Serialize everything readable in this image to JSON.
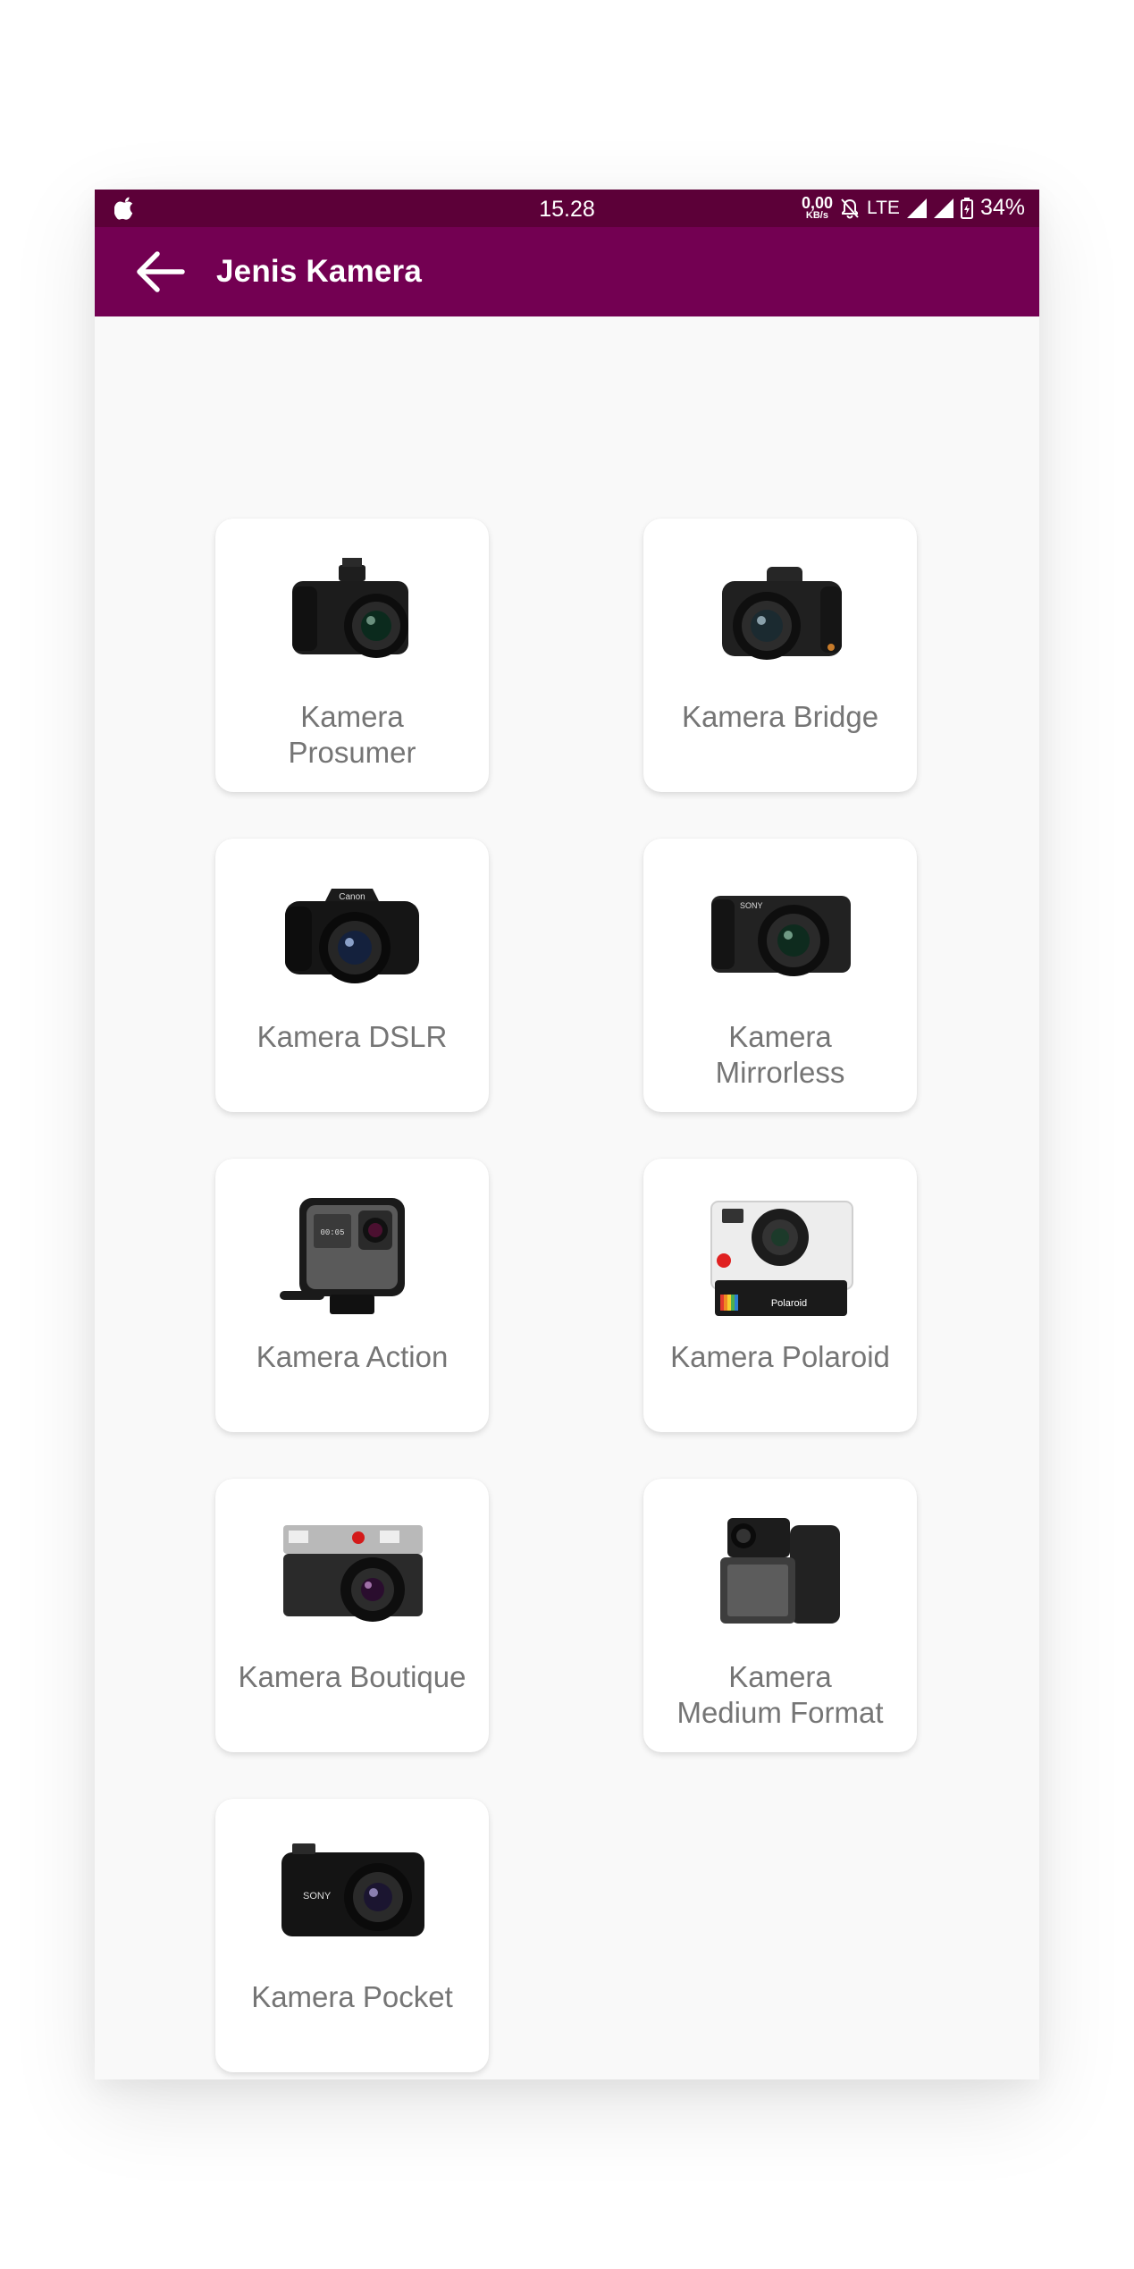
{
  "status_bar": {
    "time": "15.28",
    "net_speed_value": "0,00",
    "net_speed_unit": "KB/s",
    "network": "LTE",
    "battery": "34%"
  },
  "app_bar": {
    "title": "Jenis Kamera",
    "back_icon": "arrow-left-icon"
  },
  "colors": {
    "status_bar": "#5c0038",
    "app_bar": "#730052",
    "background": "#f9f9f9",
    "card": "#ffffff",
    "label": "#757575"
  },
  "cameras": [
    {
      "label": "Kamera\nProsumer",
      "icon": "prosumer-camera-image"
    },
    {
      "label": "Kamera Bridge",
      "icon": "bridge-camera-image"
    },
    {
      "label": "Kamera DSLR",
      "icon": "dslr-camera-image"
    },
    {
      "label": "Kamera\nMirrorless",
      "icon": "mirrorless-camera-image"
    },
    {
      "label": "Kamera Action",
      "icon": "action-camera-image"
    },
    {
      "label": "Kamera  Polaroid",
      "icon": "polaroid-camera-image"
    },
    {
      "label": "Kamera Boutique",
      "icon": "boutique-camera-image"
    },
    {
      "label": "Kamera\nMedium Format",
      "icon": "medium-format-camera-image"
    },
    {
      "label": "Kamera Pocket",
      "icon": "pocket-camera-image"
    }
  ]
}
